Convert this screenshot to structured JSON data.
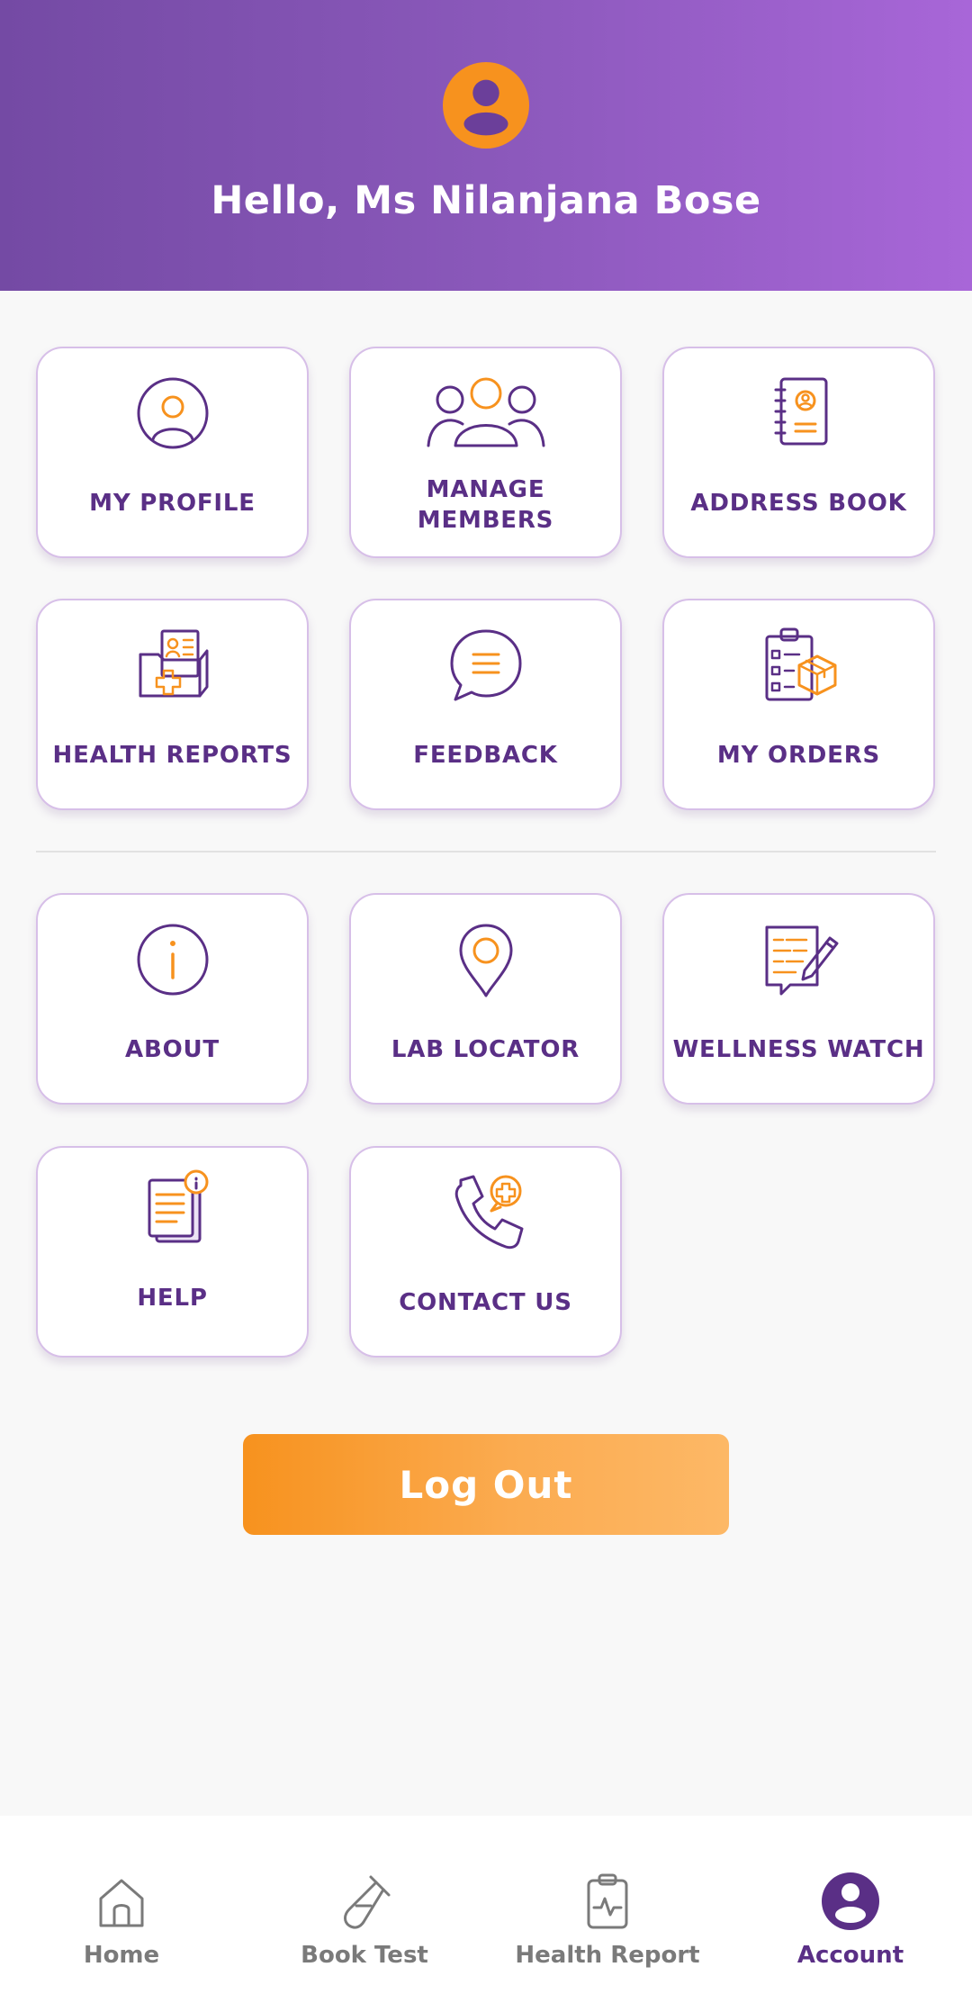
{
  "header": {
    "greeting": "Hello, Ms Nilanjana Bose",
    "avatar_icon": "user-avatar-icon"
  },
  "menu": {
    "my_profile": "MY PROFILE",
    "manage_members_line1": "MANAGE",
    "manage_members_line2": "MEMBERS",
    "address_book": "ADDRESS BOOK",
    "health_reports": "HEALTH REPORTS",
    "feedback": "FEEDBACK",
    "my_orders": "MY ORDERS",
    "about": "ABOUT",
    "lab_locator": "LAB LOCATOR",
    "wellness_watch": "WELLNESS WATCH",
    "help": "HELP",
    "contact_us": "CONTACT US"
  },
  "logout_label": "Log Out",
  "bottom_nav": {
    "home": "Home",
    "book_test": "Book Test",
    "health_report": "Health Report",
    "account": "Account",
    "active": "Account"
  },
  "colors": {
    "brand_purple": "#5a2f86",
    "accent_orange": "#f7921e",
    "header_gradient_start": "#744aa4",
    "header_gradient_end": "#a866d8"
  }
}
